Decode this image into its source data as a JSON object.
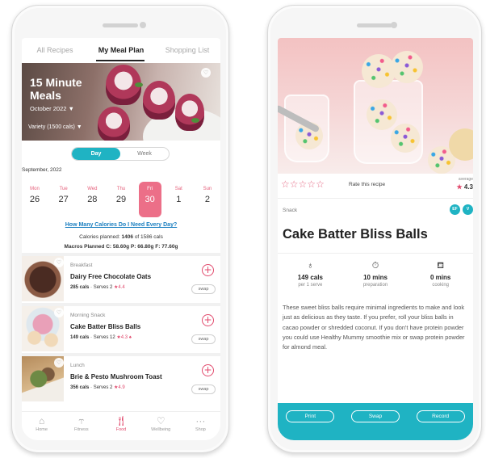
{
  "left_screen": {
    "tabs": [
      "All Recipes",
      "My Meal Plan",
      "Shopping List"
    ],
    "hero": {
      "title": "15 Minute Meals",
      "month": "October 2022",
      "variety": "Variety (1500 cals)"
    },
    "toggle": {
      "day": "Day",
      "week": "Week"
    },
    "week_label": "September, 2022",
    "days": [
      {
        "name": "Mon",
        "date": "26"
      },
      {
        "name": "Tue",
        "date": "27"
      },
      {
        "name": "Wed",
        "date": "28"
      },
      {
        "name": "Thu",
        "date": "29"
      },
      {
        "name": "Fri",
        "date": "30"
      },
      {
        "name": "Sat",
        "date": "1"
      },
      {
        "name": "Sun",
        "date": "2"
      }
    ],
    "selected_day": "Fri",
    "calorie_link": "How Many Calories Do I Need Every Day?",
    "calories_planned_label": "Calories planned:",
    "calories_planned_value": "1406",
    "calories_total": "of 1586 cals",
    "macros": "Macros Planned C: 58.60g P: 66.80g F: 77.60g",
    "meals": [
      {
        "type": "Breakfast",
        "name": "Dairy Free Chocolate Oats",
        "cals": "285 cals",
        "serves": "· Serves 2",
        "rating": "★4.4",
        "swap": "swap"
      },
      {
        "type": "Morning Snack",
        "name": "Cake Batter Bliss Balls",
        "cals": "149 cals",
        "serves": "· Serves 12",
        "rating": "★4.3 ♠",
        "swap": "swap"
      },
      {
        "type": "Lunch",
        "name": "Brie & Pesto Mushroom Toast",
        "cals": "356 cals",
        "serves": "· Serves 2",
        "rating": "★4.9",
        "swap": "swap"
      }
    ],
    "nav": [
      "Home",
      "Fitness",
      "Food",
      "Wellbeing",
      "Shop"
    ]
  },
  "right_screen": {
    "rate_label": "Rate this recipe",
    "average_label": "average",
    "average_value": "4.3",
    "category": "Snack",
    "diet_badges": [
      "EF",
      "V"
    ],
    "title": "Cake Batter Bliss Balls",
    "stats": [
      {
        "value": "149 cals",
        "label": "per 1 serve"
      },
      {
        "value": "10 mins",
        "label": "preparation"
      },
      {
        "value": "0 mins",
        "label": "cooking"
      }
    ],
    "description": "These sweet bliss balls require minimal ingredients to make and look just as delicious as they taste. If you prefer, roll your bliss balls in cacao powder or shredded coconut. If you don't have protein powder you could use Healthy Mummy smoothie mix or swap protein powder for almond meal.",
    "actions": [
      "Print",
      "Swap",
      "Record"
    ]
  },
  "colors": {
    "accent_teal": "#1fb3c3",
    "accent_pink": "#e14a6d"
  }
}
